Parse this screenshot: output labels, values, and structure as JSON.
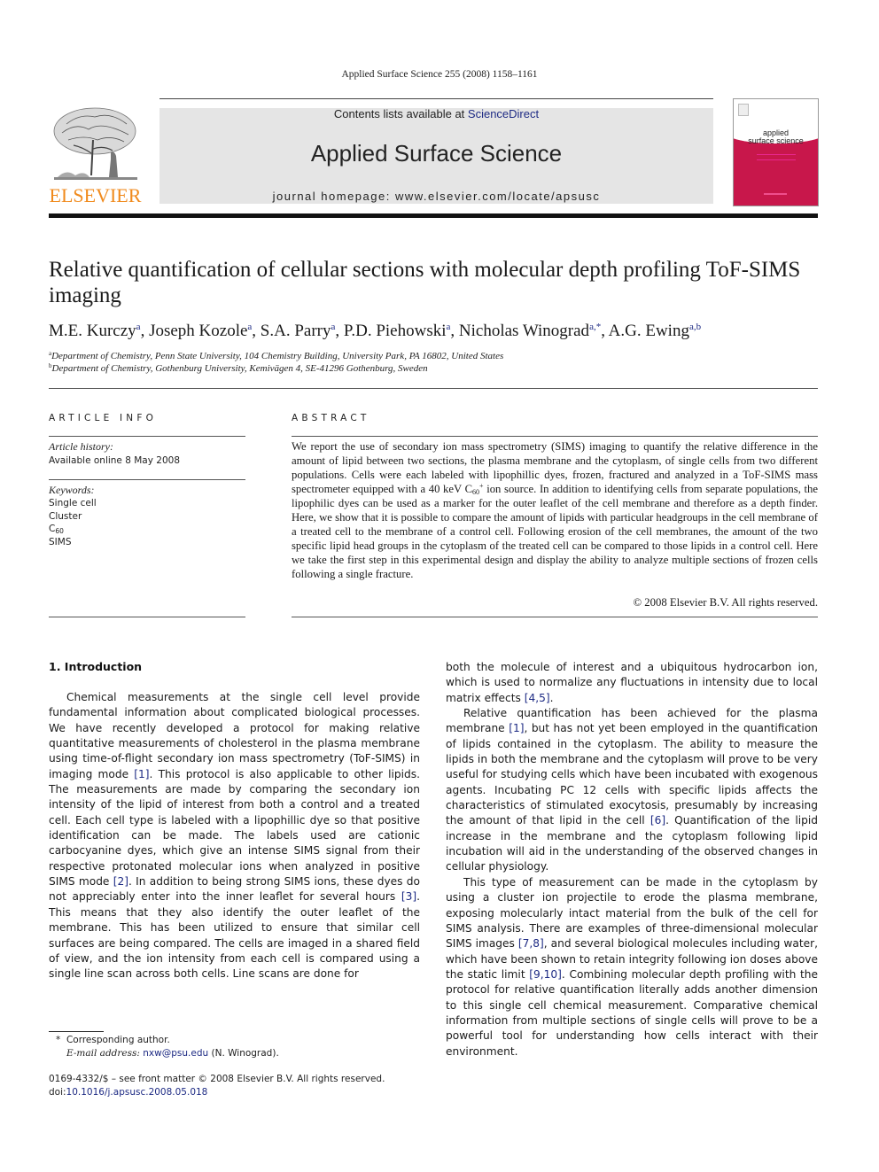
{
  "running_head": "Applied Surface Science 255 (2008) 1158–1161",
  "masthead": {
    "publisher_wordmark": "ELSEVIER",
    "publisher_logo_icon": "elsevier-tree-icon",
    "contents_prefix": "Contents lists available at ",
    "contents_link": "ScienceDirect",
    "journal_name": "Applied Surface Science",
    "homepage": "journal homepage: www.elsevier.com/locate/apsusc",
    "cover_title_line1": "applied",
    "cover_title_line2": "surface science",
    "colors": {
      "elsevier_orange": "#f08a1c",
      "cover_red": "#c8174b",
      "banner_gray": "#e5e5e5",
      "link_blue": "#1e2b84"
    }
  },
  "article": {
    "title": "Relative quantification of cellular sections with molecular depth profiling ToF-SIMS imaging",
    "authors": [
      {
        "name": "M.E. Kurczy",
        "sup": "a"
      },
      {
        "name": "Joseph Kozole",
        "sup": "a"
      },
      {
        "name": "S.A. Parry",
        "sup": "a"
      },
      {
        "name": "P.D. Piehowski",
        "sup": "a"
      },
      {
        "name": "Nicholas Winograd",
        "sup": "a,*"
      },
      {
        "name": "A.G. Ewing",
        "sup": "a,b"
      }
    ],
    "affiliations": [
      {
        "key": "a",
        "text": "Department of Chemistry, Penn State University, 104 Chemistry Building, University Park, PA 16802, United States"
      },
      {
        "key": "b",
        "text": "Department of Chemistry, Gothenburg University, Kemivägen 4, SE-41296 Gothenburg, Sweden"
      }
    ]
  },
  "article_info": {
    "heading": "ARTICLE INFO",
    "history_label": "Article history:",
    "history_value": "Available online 8 May 2008",
    "keywords_label": "Keywords:",
    "keywords": [
      "Single cell",
      "Cluster",
      "C60",
      "SIMS"
    ]
  },
  "abstract": {
    "heading": "ABSTRACT",
    "text_part1": "We report the use of secondary ion mass spectrometry (SIMS) imaging to quantify the relative difference in the amount of lipid between two sections, the plasma membrane and the cytoplasm, of single cells from two different populations. Cells were each labeled with lipophillic dyes, frozen, fractured and analyzed in a ToF-SIMS mass spectrometer equipped with a 40 keV C",
    "text_sub": "60",
    "text_sup": "+",
    "text_part2": " ion source. In addition to identifying cells from separate populations, the lipophilic dyes can be used as a marker for the outer leaflet of the cell membrane and therefore as a depth finder. Here, we show that it is possible to compare the amount of lipids with particular headgroups in the cell membrane of a treated cell to the membrane of a control cell. Following erosion of the cell membranes, the amount of the two specific lipid head groups in the cytoplasm of the treated cell can be compared to those lipids in a control cell. Here we take the first step in this experimental design and display the ability to analyze multiple sections of frozen cells following a single fracture.",
    "copyright": "© 2008 Elsevier B.V. All rights reserved."
  },
  "body": {
    "section_heading": "1.  Introduction",
    "left_col": {
      "p1_a": "Chemical measurements at the single cell level provide fundamental information about complicated biological processes. We have recently developed a protocol for making relative quantitative measurements of cholesterol in the plasma membrane using time-of-flight secondary ion mass spectrometry (ToF-SIMS) in imaging mode ",
      "ref1": "[1]",
      "p1_b": ". This protocol is also applicable to other lipids. The measurements are made by comparing the secondary ion intensity of the lipid of interest from both a control and a treated cell. Each cell type is labeled with a lipophillic dye so that positive identification can be made. The labels used are cationic carbocyanine dyes, which give an intense SIMS signal from their respective protonated molecular ions when analyzed in positive SIMS mode ",
      "ref2": "[2]",
      "p1_c": ". In addition to being strong SIMS ions, these dyes do not appreciably enter into the inner leaflet for several hours ",
      "ref3": "[3]",
      "p1_d": ". This means that they also identify the outer leaflet of the membrane. This has been utilized to ensure that similar cell surfaces are being compared. The cells are imaged in a shared field of view, and the ion intensity from each cell is compared using a single line scan across both cells. Line scans are done for"
    },
    "right_col": {
      "p1_a": "both the molecule of interest and a ubiquitous hydrocarbon ion, which is used to normalize any fluctuations in intensity due to local matrix effects ",
      "ref45": "[4,5]",
      "p1_b": ".",
      "p2_a": "Relative quantification has been achieved for the plasma membrane ",
      "ref1": "[1]",
      "p2_b": ", but has not yet been employed in the quantification of lipids contained in the cytoplasm. The ability to measure the lipids in both the membrane and the cytoplasm will prove to be very useful for studying cells which have been incubated with exogenous agents. Incubating PC 12 cells with specific lipids affects the characteristics of stimulated exocytosis, presumably by increasing the amount of that lipid in the cell ",
      "ref6": "[6]",
      "p2_c": ". Quantification of the lipid increase in the membrane and the cytoplasm following lipid incubation will aid in the understanding of the observed changes in cellular physiology.",
      "p3_a": "This type of measurement can be made in the cytoplasm by using a cluster ion projectile to erode the plasma membrane, exposing molecularly intact material from the bulk of the cell for SIMS analysis. There are examples of three-dimensional molecular SIMS images ",
      "ref78": "[7,8]",
      "p3_b": ", and several biological molecules including water, which have been shown to retain integrity following ion doses above the static limit ",
      "ref910": "[9,10]",
      "p3_c": ". Combining molecular depth profiling with the protocol for relative quantification literally adds another dimension to this single cell chemical measurement. Comparative chemical information from multiple sections of single cells will prove to be a powerful tool for understanding how cells interact with their environment."
    }
  },
  "footnotes": {
    "star": "*",
    "corresponding": "Corresponding author.",
    "email_label": "E-mail address:",
    "email": "nxw@psu.edu",
    "email_suffix": " (N. Winograd).",
    "front_matter": "0169-4332/$ – see front matter © 2008 Elsevier B.V. All rights reserved.",
    "doi_prefix": "doi:",
    "doi": "10.1016/j.apsusc.2008.05.018"
  }
}
